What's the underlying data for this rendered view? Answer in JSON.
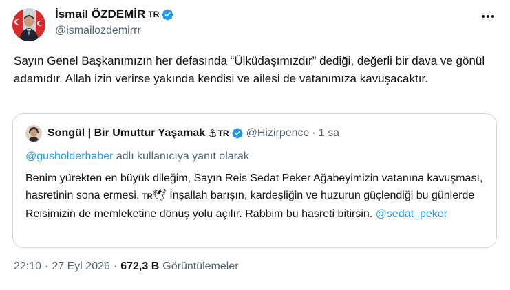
{
  "author": {
    "display_name": "İsmail ÖZDEMİR",
    "flag": "TR",
    "handle": "@ismailozdemirrr",
    "verified_color": "#1d9bf0"
  },
  "more_icon": "more-horizontal-icon",
  "tweet_text": "Sayın Genel Başkanımızın her defasında “Ülküdaşımızdır” dediği, değerli bir dava ve gönül adamıdır. Allah izin verirse yakında kendisi ve ailesi de vatanımıza kavuşacaktır.",
  "quote": {
    "display_name": "Songül | Bir Umuttur Yaşamak",
    "anchor_emoji": "⚓",
    "flag": "TR",
    "handle": "@Hizirpence",
    "dot": "·",
    "time": "1 sa",
    "reply_mention": "@gusholderhaber",
    "reply_suffix": " adlı kullanıcıya yanıt olarak",
    "text_part1": "Benim yürekten en büyük dileğim, Sayın Reis Sedat Peker Ağabeyimizin vatanına kavuşması, hasretinin sona ermesi. ",
    "inline_flag": "TR",
    "dove_emoji": "🕊",
    "text_part2": " İnşallah barışın, kardeşliğin ve huzurun güçlendiği bu günlerde Reisimizin de memleketine dönüş yolu açılır. Rabbim bu hasreti bitirsin.  ",
    "end_mention": "@sedat_peker"
  },
  "meta": {
    "time": "22:10",
    "dot": "·",
    "date": "27 Eyl 2026",
    "views_count": "672,3 B",
    "views_label": "Görüntülemeler"
  },
  "colors": {
    "accent": "#1d9bf0",
    "text": "#0f1419",
    "secondary": "#536471",
    "border": "#cfd9de"
  }
}
